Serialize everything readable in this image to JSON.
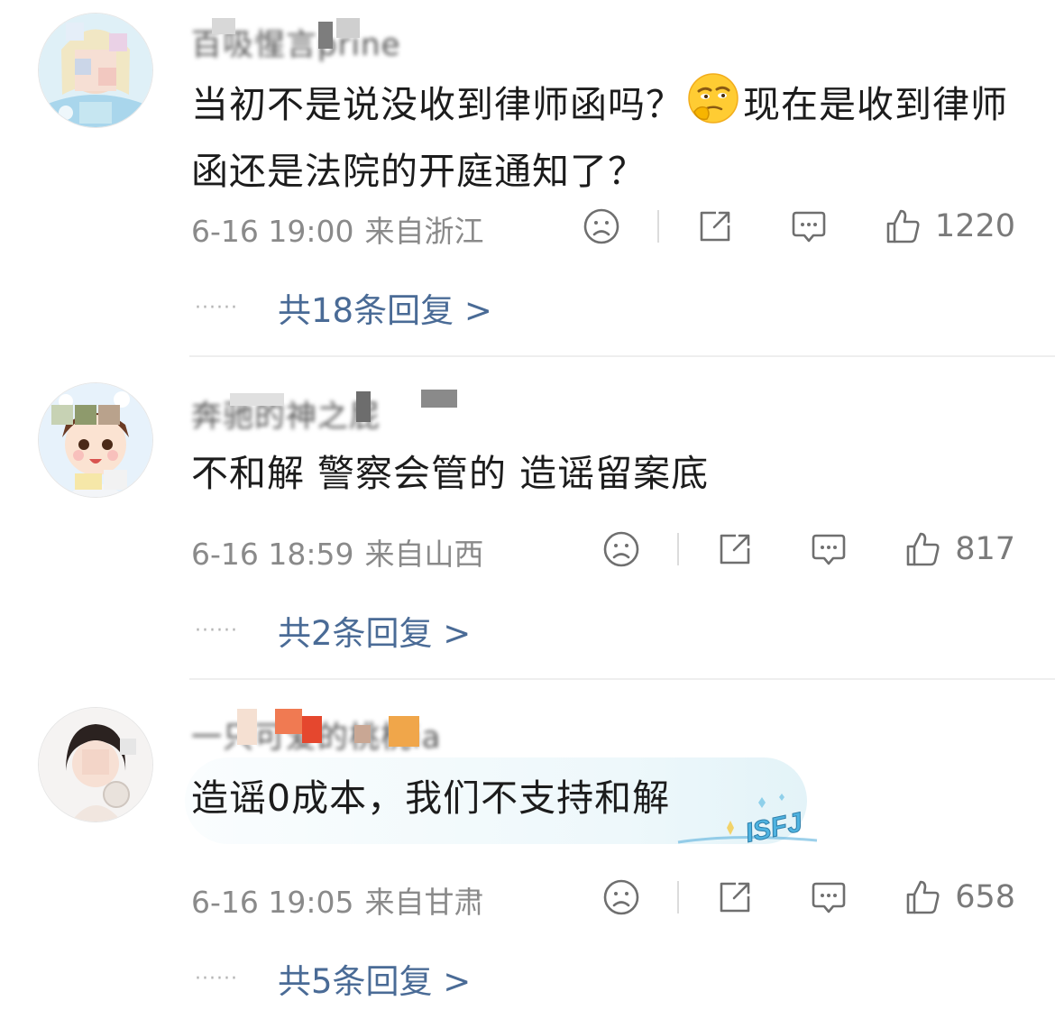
{
  "comments": [
    {
      "username": "百吸惺言prine",
      "text": "当初不是说没收到律师函吗？",
      "emoji_icon": "thinking-face-emoji",
      "text_after": "现在是收到律师函还是法院的开庭通知了？",
      "date": "6-16 19:00",
      "region": "来自浙江",
      "likes": "1220",
      "replies": "共18条回复 >"
    },
    {
      "username": "奔驰的神之屁",
      "text": "不和解 警察会管的 造谣留案底",
      "date": "6-16 18:59",
      "region": "来自山西",
      "likes": "817",
      "replies": "共2条回复 >"
    },
    {
      "username": "一只可爱的桃桃ia",
      "text": "造谣0成本，我们不支持和解",
      "date": "6-16 19:05",
      "region": "来自甘肃",
      "likes": "658",
      "replies": "共5条回复 >",
      "bubble_badge": "ISFJ"
    }
  ],
  "colors": {
    "reply_link": "#4a6b96",
    "meta_text": "#8a8a8a",
    "body_text": "#1c1c1c"
  },
  "icons": [
    "sad-face-icon",
    "share-icon",
    "comment-icon",
    "thumbs-up-icon"
  ]
}
